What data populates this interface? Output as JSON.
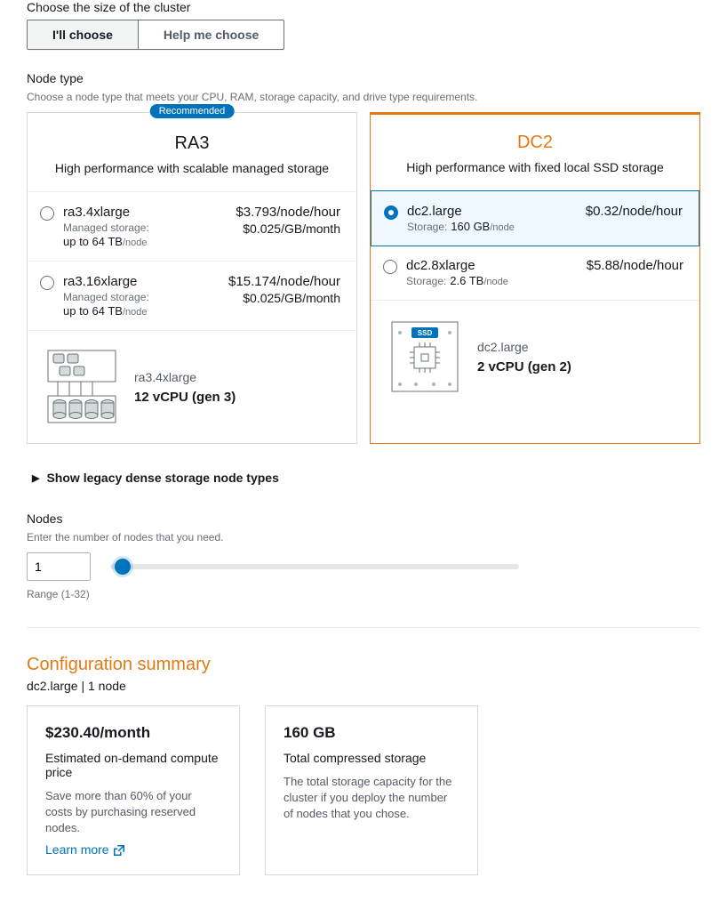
{
  "clusterSize": {
    "label": "Choose the size of the cluster",
    "choose": "I'll choose",
    "helpMe": "Help me choose"
  },
  "nodeType": {
    "label": "Node type",
    "desc": "Choose a node type that meets your CPU, RAM, storage capacity, and drive type requirements.",
    "recommended": "Recommended",
    "ra3": {
      "title": "RA3",
      "subtitle": "High performance with scalable managed storage",
      "options": [
        {
          "name": "ra3.4xlarge",
          "storeLabel": "Managed storage:",
          "storeVal": "up to 64 TB",
          "storeSuffix": "/node",
          "price": "$3.793/node/hour",
          "price2": "$0.025/GB/month"
        },
        {
          "name": "ra3.16xlarge",
          "storeLabel": "Managed storage:",
          "storeVal": "up to 64 TB",
          "storeSuffix": "/node",
          "price": "$15.174/node/hour",
          "price2": "$0.025/GB/month"
        }
      ],
      "spec": {
        "name": "ra3.4xlarge",
        "cpu": "12 vCPU (gen 3)"
      }
    },
    "dc2": {
      "title": "DC2",
      "subtitle": "High performance with fixed local SSD storage",
      "options": [
        {
          "name": "dc2.large",
          "storeLabel": "Storage:",
          "storeVal": "160 GB",
          "storeSuffix": "/node",
          "price": "$0.32/node/hour"
        },
        {
          "name": "dc2.8xlarge",
          "storeLabel": "Storage:",
          "storeVal": "2.6 TB",
          "storeSuffix": "/node",
          "price": "$5.88/node/hour"
        }
      ],
      "spec": {
        "name": "dc2.large",
        "cpu": "2 vCPU (gen 2)",
        "ssd": "SSD"
      }
    },
    "legacy": "Show legacy dense storage node types"
  },
  "nodes": {
    "label": "Nodes",
    "desc": "Enter the number of nodes that you need.",
    "value": "1",
    "range": "Range (1-32)"
  },
  "summary": {
    "title": "Configuration summary",
    "subtitle": "dc2.large | 1 node",
    "cost": {
      "big": "$230.40/month",
      "mid": "Estimated on-demand compute price",
      "small": "Save more than 60% of your costs by purchasing reserved nodes.",
      "learn": "Learn more"
    },
    "storage": {
      "big": "160 GB",
      "mid": "Total compressed storage",
      "small": "The total storage capacity for the cluster if you deploy the number of nodes that you chose."
    }
  }
}
